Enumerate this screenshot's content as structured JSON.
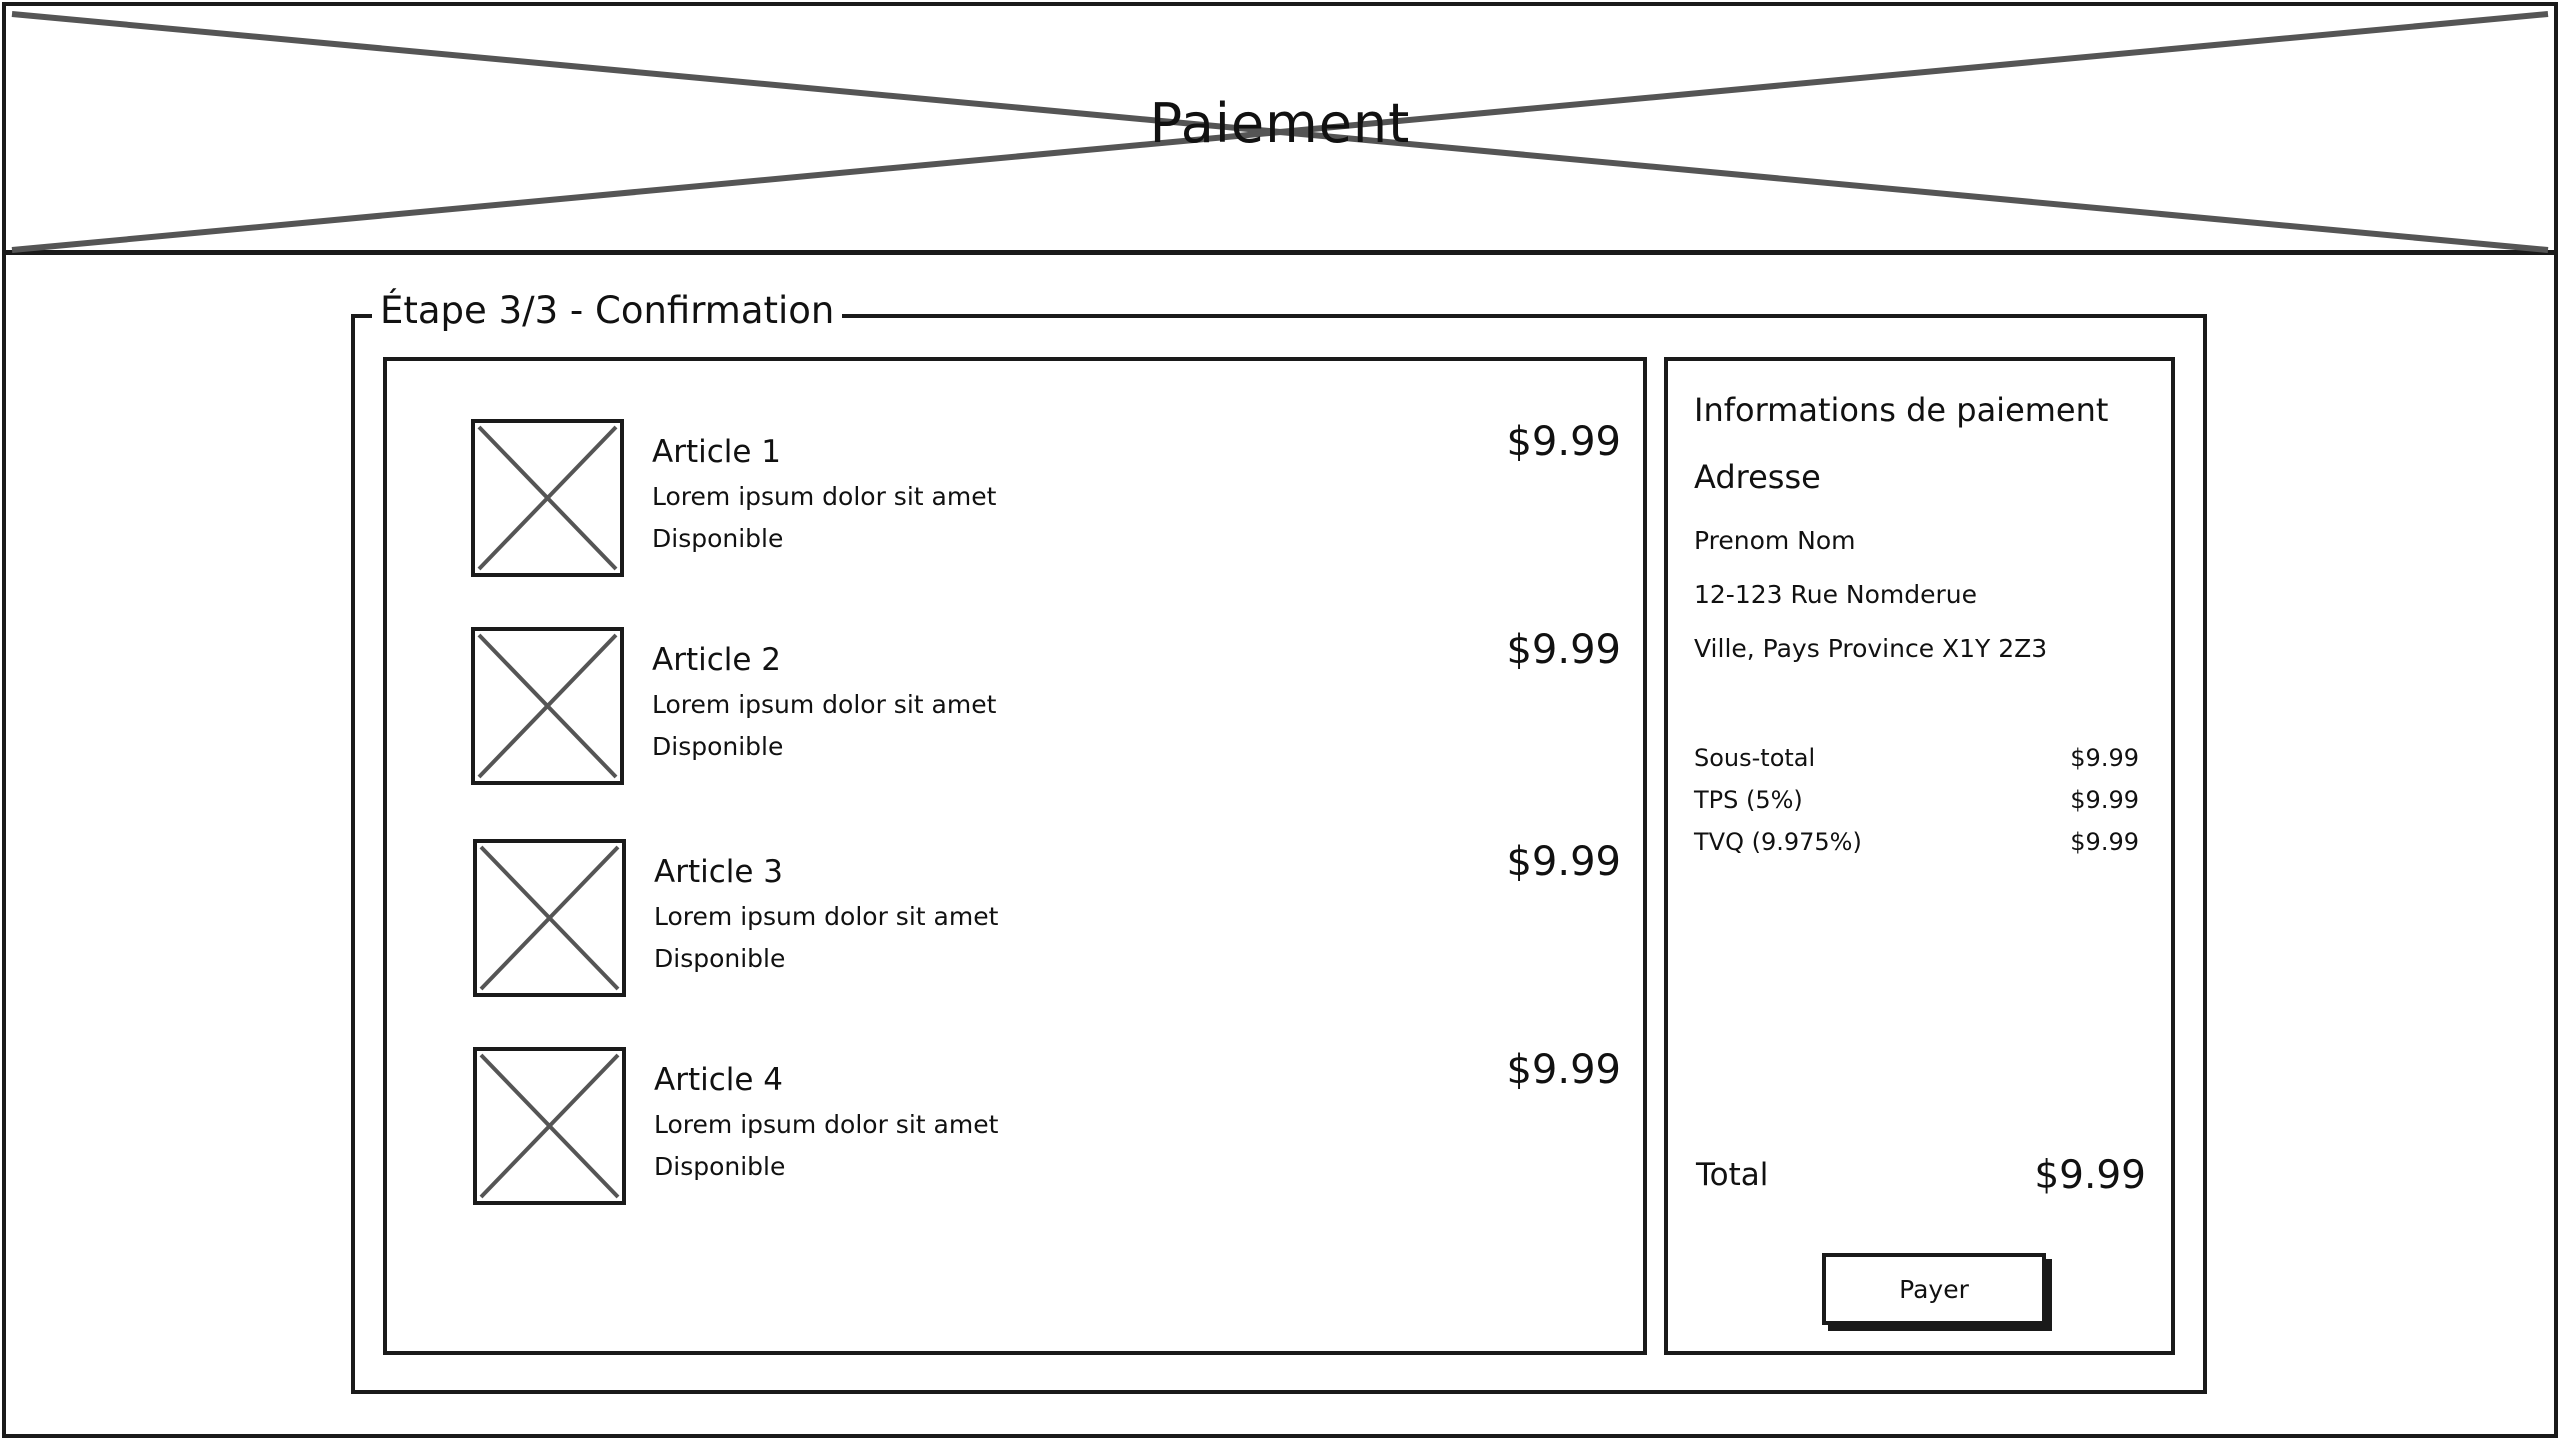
{
  "header": {
    "title": "Paiement"
  },
  "step": {
    "legend": "Étape 3/3 - Confirmation"
  },
  "items": [
    {
      "name": "Article 1",
      "description": "Lorem ipsum dolor sit amet",
      "status": "Disponible",
      "price": "$9.99"
    },
    {
      "name": "Article 2",
      "description": "Lorem ipsum dolor sit amet",
      "status": "Disponible",
      "price": "$9.99"
    },
    {
      "name": "Article 3",
      "description": "Lorem ipsum dolor sit amet",
      "status": "Disponible",
      "price": "$9.99"
    },
    {
      "name": "Article 4",
      "description": "Lorem ipsum dolor sit amet",
      "status": "Disponible",
      "price": "$9.99"
    }
  ],
  "payment": {
    "heading": "Informations de paiement",
    "address_heading": "Adresse",
    "address_name": "Prenom Nom",
    "address_street": "12-123 Rue Nomderue",
    "address_city": "Ville, Pays Province X1Y 2Z3",
    "summary": [
      {
        "label": "Sous-total",
        "value": "$9.99"
      },
      {
        "label": "TPS (5%)",
        "value": "$9.99"
      },
      {
        "label": "TVQ (9.975%)",
        "value": "$9.99"
      }
    ],
    "total_label": "Total",
    "total_value": "$9.99",
    "pay_button": "Payer"
  },
  "icons": {
    "header_image": "image-placeholder-icon",
    "item_thumbnail": "image-placeholder-icon"
  },
  "colors": {
    "stroke": "#1a1a1a",
    "placeholder_line": "#555555",
    "background": "#ffffff"
  }
}
